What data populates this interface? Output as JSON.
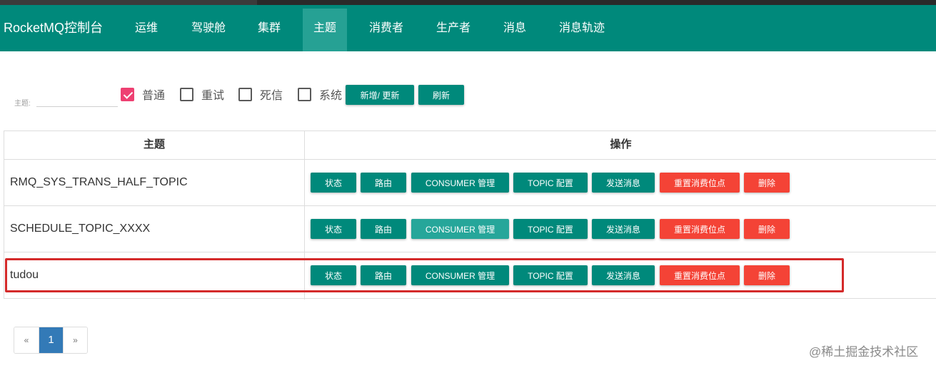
{
  "colors": {
    "primary": "#00897b",
    "danger": "#f44336",
    "checkbox_checked": "#ee4072",
    "highlight": "#d42a2a",
    "page_active": "#337ab7"
  },
  "navbar": {
    "brand": "RocketMQ控制台",
    "items": [
      {
        "label": "运维"
      },
      {
        "label": "驾驶舱"
      },
      {
        "label": "集群"
      },
      {
        "label": "主题"
      },
      {
        "label": "消费者"
      },
      {
        "label": "生产者"
      },
      {
        "label": "消息"
      },
      {
        "label": "消息轨迹"
      }
    ]
  },
  "filter": {
    "label": "主题:",
    "value": "",
    "checkboxes": [
      {
        "label": "普通",
        "checked": true
      },
      {
        "label": "重试",
        "checked": false
      },
      {
        "label": "死信",
        "checked": false
      },
      {
        "label": "系统",
        "checked": false
      }
    ],
    "add_button": "新增/ 更新",
    "refresh_button": "刷新"
  },
  "table": {
    "headers": [
      "主题",
      "操作"
    ],
    "actions": [
      "状态",
      "路由",
      "CONSUMER 管理",
      "TOPIC 配置",
      "发送消息",
      "重置消费位点",
      "删除"
    ],
    "rows": [
      {
        "topic": "RMQ_SYS_TRANS_HALF_TOPIC"
      },
      {
        "topic": "SCHEDULE_TOPIC_XXXX"
      },
      {
        "topic": "tudou"
      }
    ]
  },
  "pagination": {
    "prev": "«",
    "current": "1",
    "next": "»"
  },
  "watermark": "@稀土掘金技术社区"
}
